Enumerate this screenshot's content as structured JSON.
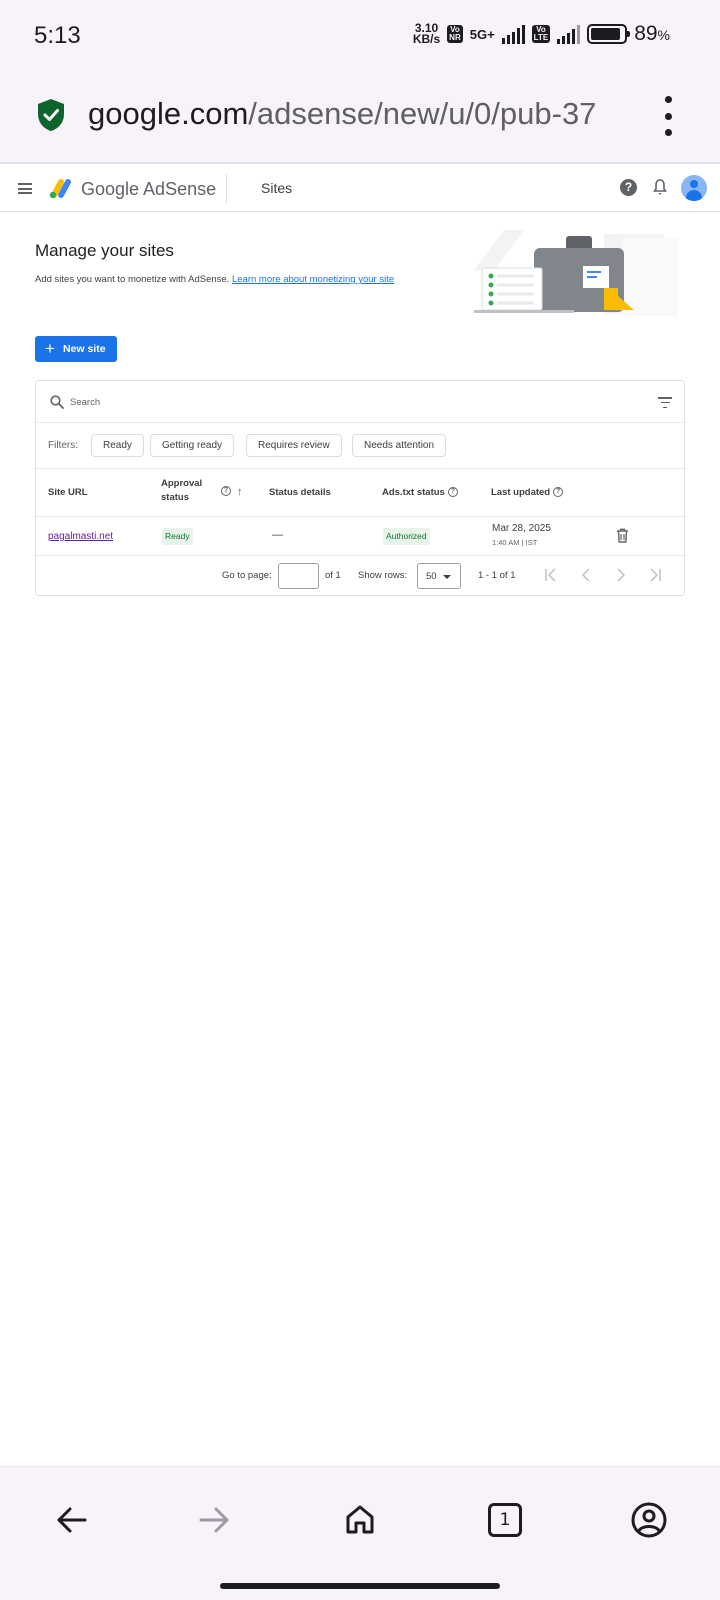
{
  "status_bar": {
    "time": "5:13",
    "speed_value": "3.10",
    "speed_unit": "KB/s",
    "sim1_badge_top": "Vo",
    "sim1_badge_bottom": "NR",
    "network": "5G+",
    "sim2_badge_top": "Vo",
    "sim2_badge_bottom": "LTE",
    "battery_level": 0.89,
    "battery_pct": "89",
    "pct_sign": "%"
  },
  "browser": {
    "url_host": "google.com",
    "url_path": "/adsense/new/u/0/pub-37"
  },
  "header": {
    "brand": "Google AdSense",
    "section": "Sites",
    "help_glyph": "?"
  },
  "page": {
    "title": "Manage your sites",
    "description": "Add sites you want to monetize with AdSense.",
    "learn_more": "Learn more about monetizing your site",
    "new_site_label": "New site",
    "plus_glyph": "+"
  },
  "table": {
    "search_placeholder": "Search",
    "filters_label": "Filters:",
    "filter_chips": [
      "Ready",
      "Getting ready",
      "Requires review",
      "Needs attention"
    ],
    "columns": {
      "site_url": "Site URL",
      "approval_line1": "Approval",
      "approval_line2": "status",
      "status_details": "Status details",
      "ads_txt": "Ads.txt status",
      "last_updated": "Last updated"
    },
    "help_glyph": "?",
    "sort_glyph": "↑",
    "rows": [
      {
        "site": "pagalmasti.net",
        "approval": "Ready",
        "details": "—",
        "ads_txt": "Authorized",
        "updated_date": "Mar 28, 2025",
        "updated_time": "1:40 AM | IST"
      }
    ],
    "pagination": {
      "go_to_page": "Go to page:",
      "page_value": "",
      "of_pages": "of 1",
      "show_rows": "Show rows:",
      "rows_value": "50",
      "range": "1 - 1 of 1"
    }
  },
  "bottom_nav": {
    "tab_count": "1"
  }
}
